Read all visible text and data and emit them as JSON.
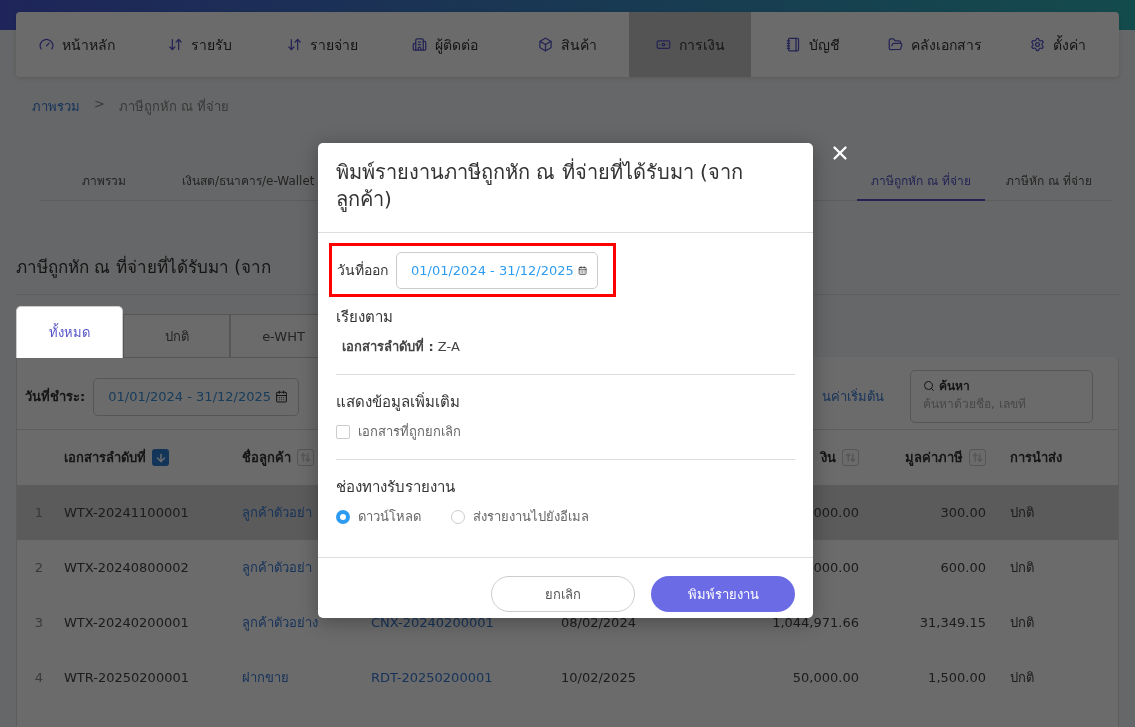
{
  "nav": {
    "items": [
      {
        "label": "หน้าหลัก",
        "selected": false
      },
      {
        "label": "รายรับ",
        "selected": false
      },
      {
        "label": "รายจ่าย",
        "selected": false
      },
      {
        "label": "ผู้ติดต่อ",
        "selected": false
      },
      {
        "label": "สินค้า",
        "selected": false
      },
      {
        "label": "การเงิน",
        "selected": true
      },
      {
        "label": "บัญชี",
        "selected": false
      },
      {
        "label": "คลังเอกสาร",
        "selected": false
      },
      {
        "label": "ตั้งค่า",
        "selected": false
      }
    ]
  },
  "breadcrumb": [
    {
      "label": "ภาพรวม",
      "kind": "link"
    },
    {
      "label": ">",
      "kind": "separator"
    },
    {
      "label": "ภาษีถูกหัก ณ ที่จ่าย",
      "kind": "current"
    }
  ],
  "section_tabs": {
    "left": [
      {
        "label": "ภาพรวม",
        "selected": false
      },
      {
        "label": "เงินสด/ธนาคาร/e-Wallet",
        "selected": false
      }
    ],
    "right": [
      {
        "label": "ภาษีถูกหัก ณ ที่จ่าย",
        "selected": true
      },
      {
        "label": "ภาษีหัก ณ ที่จ่าย",
        "selected": false
      }
    ]
  },
  "page_title": "ภาษีถูกหัก ณ ที่จ่ายที่ได้รับมา (จาก",
  "status_tabs": [
    {
      "label": "ทั้งหมด",
      "selected": true
    },
    {
      "label": "ปกติ",
      "selected": false
    },
    {
      "label": "e-WHT",
      "selected": false
    }
  ],
  "filter": {
    "label": "วันที่ชำระ:",
    "value": "01/01/2024 - 31/12/2025"
  },
  "reset_link": "นค่าเริ่มต้น",
  "search": {
    "label": "ค้นหา",
    "placeholder": "ค้นหาด้วยชื่อ, เลขที่"
  },
  "table": {
    "columns": [
      {
        "kind": "document",
        "label": "เอกสารลำดับที่",
        "sort_active": true
      },
      {
        "kind": "customer",
        "label": "ชื่อลูกค้า",
        "sort_active": false
      },
      {
        "kind": "amount",
        "label": "งิน",
        "sort_active": false
      },
      {
        "kind": "tax",
        "label": "มูลค่าภาษี",
        "sort_active": false
      },
      {
        "kind": "delivery",
        "label": "การนำส่ง"
      }
    ],
    "rows": [
      {
        "hovered": true,
        "no": "1",
        "document": "WTX-20241100001",
        "customer": "ลูกค้าตัวอย่า",
        "amount": "000.00",
        "tax": "300.00",
        "delivery": "ปกติ"
      },
      {
        "hovered": false,
        "no": "2",
        "document": "WTX-20240800002",
        "customer": "ลูกค้าตัวอย่า",
        "amount": "000.00",
        "tax": "600.00",
        "delivery": "ปกติ"
      },
      {
        "hovered": false,
        "no": "3",
        "document": "WTX-20240200001",
        "customer": "ลูกค้าตัวอย่าง",
        "reference": "CNX-20240200001",
        "date": "08/02/2024",
        "amount": "1,044,971.66",
        "tax": "31,349.15",
        "delivery": "ปกติ"
      },
      {
        "hovered": false,
        "no": "4",
        "document": "WTR-20250200001",
        "customer": "ฝากขาย",
        "reference": "RDT-20250200001",
        "date": "10/02/2025",
        "amount": "50,000.00",
        "tax": "1,500.00",
        "delivery": "ปกติ"
      }
    ]
  },
  "modal": {
    "title": "พิมพ์รายงานภาษีถูกหัก ณ ที่จ่ายที่ได้รับมา (จากลูกค้า)",
    "date": {
      "label": "วันที่ออก",
      "value": "01/01/2024 - 31/12/2025",
      "highlighted": true
    },
    "sort": {
      "heading": "เรียงตาม",
      "text": "**เอกสารลำดับที่ :** Z-A"
    },
    "extra": {
      "heading": "แสดงข้อมูลเพิ่มเติม",
      "options": [
        {
          "label": "เอกสารที่ถูกยกเลิก",
          "checked": false
        }
      ]
    },
    "channel": {
      "heading": "ช่องทางรับรายงาน",
      "options": [
        {
          "label": "ดาวน์โหลด",
          "selected": true
        },
        {
          "label": "ส่งรายงานไปยังอีเมล",
          "selected": false
        }
      ]
    },
    "buttons": [
      {
        "label": "ยกเลิก",
        "kind": "secondary"
      },
      {
        "label": "พิมพ์รายงาน",
        "kind": "primary"
      }
    ]
  }
}
